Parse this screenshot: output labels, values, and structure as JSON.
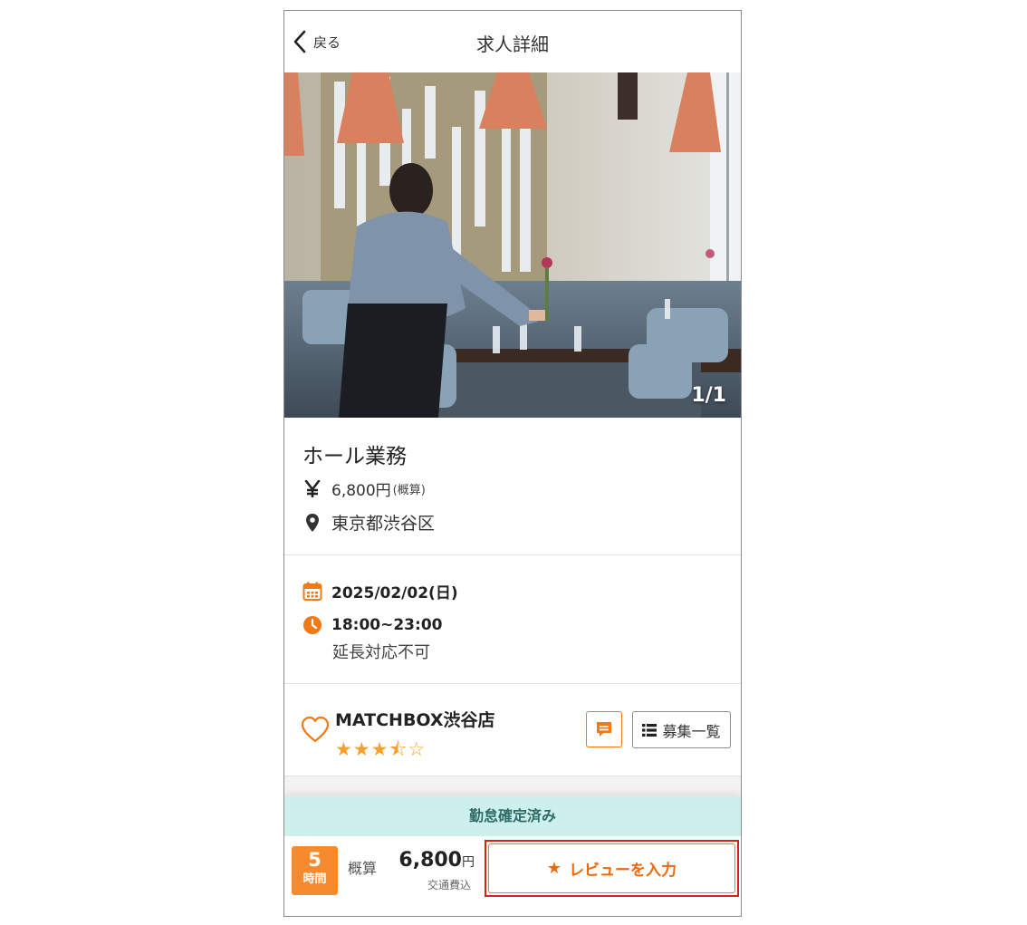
{
  "header": {
    "back_label": "戻る",
    "title": "求人詳細"
  },
  "photo": {
    "counter": "1/1"
  },
  "job": {
    "title": "ホール業務",
    "wage_amount": "6,800円",
    "wage_note": "(概算)",
    "address": "東京都渋谷区"
  },
  "schedule": {
    "date": "2025/02/02(日)",
    "time": "18:00~23:00",
    "extension_note": "延長対応不可"
  },
  "shop": {
    "name": "MATCHBOX渋谷店",
    "rating_stars": "★★★⯪☆",
    "rating": 3.5,
    "list_button_label": "募集一覧"
  },
  "status": {
    "label": "勤怠確定済み"
  },
  "footer": {
    "hours_value": "5",
    "hours_unit": "時間",
    "estimate_label": "概算",
    "pay_amount": "6,800",
    "pay_unit": "円",
    "transport_note": "交通費込",
    "review_button_label": "レビューを入力"
  },
  "colors": {
    "accent_orange": "#f07a16",
    "status_bg": "#cdf0ec",
    "highlight_red": "#d62020",
    "star": "#f4a12e"
  },
  "icons": [
    "chevron-left-icon",
    "yen-icon",
    "map-pin-icon",
    "calendar-icon",
    "clock-icon",
    "heart-icon",
    "message-icon",
    "list-icon",
    "star-icon"
  ]
}
